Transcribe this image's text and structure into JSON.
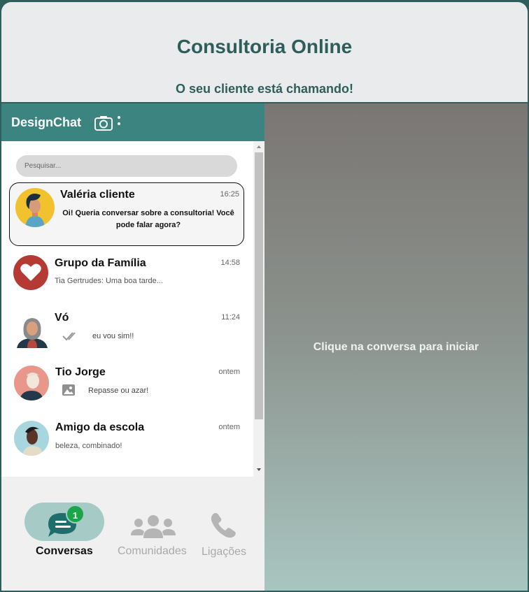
{
  "page": {
    "title": "Consultoria Online",
    "subtitle": "O seu cliente está chamando!"
  },
  "app": {
    "brand": "DesignChat",
    "search_placeholder": "Pesquisar...",
    "chats": [
      {
        "name": "Valéria cliente",
        "time": "16:25",
        "preview": "Oi! Queria conversar sobre a consultoria! Você pode falar agora?",
        "selected": true
      },
      {
        "name": "Grupo da Família",
        "time": "14:58",
        "preview": "Tia Gertrudes: Uma boa tarde..."
      },
      {
        "name": "Vó",
        "time": "11:24",
        "preview": "eu vou sim!!",
        "icon": "double-check-icon"
      },
      {
        "name": "Tio Jorge",
        "time": "ontem",
        "preview": "Repasse ou azar!",
        "icon": "image-icon"
      },
      {
        "name": "Amigo da escola",
        "time": "ontem",
        "preview": "beleza, combinado!"
      }
    ],
    "nav": {
      "conversas": "Conversas",
      "conversas_badge": "1",
      "comunidades": "Comunidades",
      "ligacoes": "Ligações"
    },
    "empty_hint": "Clique na conversa para iniciar"
  },
  "colors": {
    "header": "#3b8480",
    "title": "#2e5e5b",
    "pill": "#a6cac6",
    "badge": "#1aa54b"
  }
}
